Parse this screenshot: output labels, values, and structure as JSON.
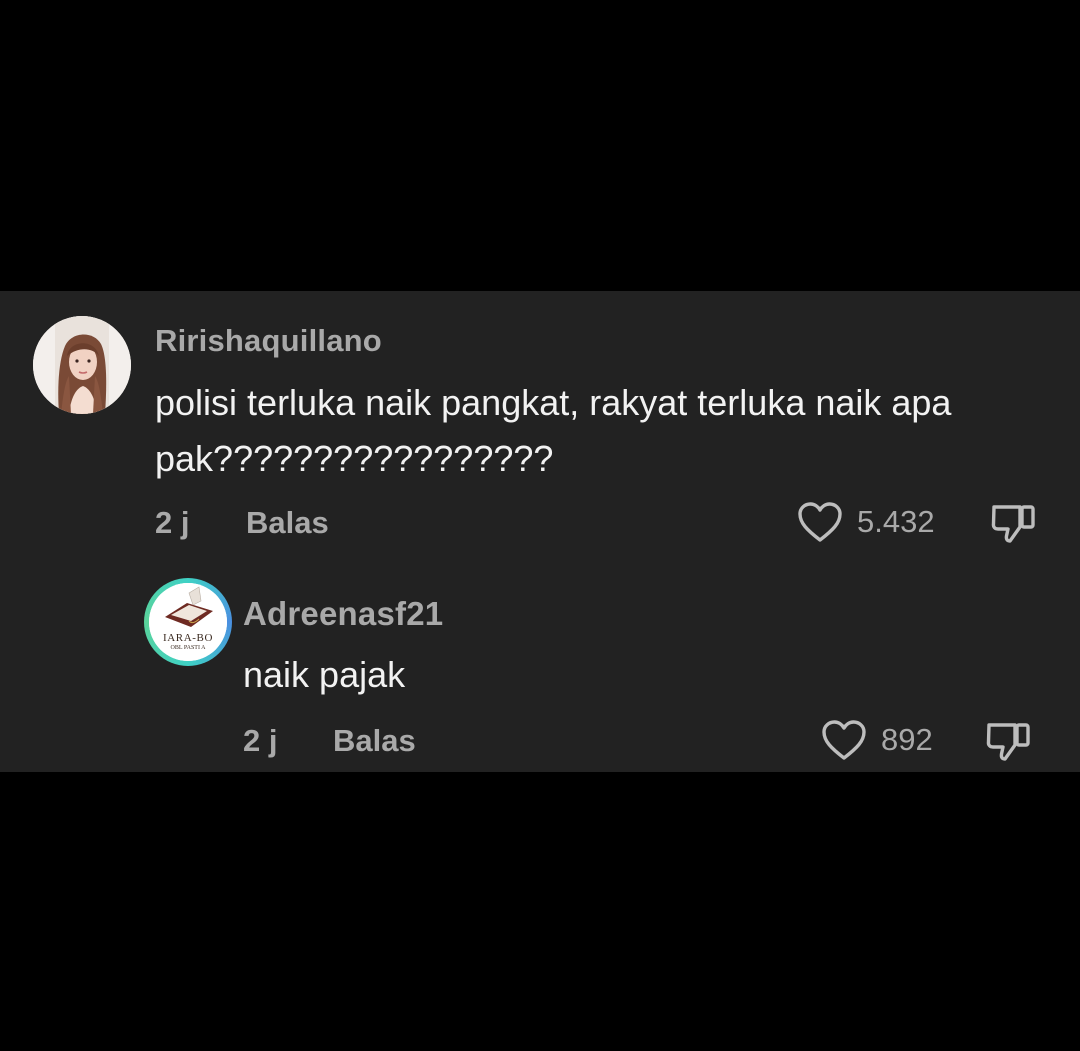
{
  "comments": [
    {
      "username": "Ririshaquillano",
      "text": "polisi terluka naik pangkat, rakyat terluka naik apa pak?????????????????",
      "time": "2 j",
      "reply_label": "Balas",
      "likes": "5.432",
      "avatar_icon": "woman-portrait-avatar"
    },
    {
      "username": "Adreenasf21",
      "text": "naik pajak",
      "time": "2 j",
      "reply_label": "Balas",
      "likes": "892",
      "avatar_icon": "book-logo-avatar",
      "avatar_logo_text_top": "IARA-BO",
      "avatar_logo_text_bottom": "OBL PASTI A"
    }
  ],
  "colors": {
    "page_background": "#000000",
    "panel_background": "#222222",
    "username": "#a9a9a9",
    "comment_text": "#f2f2f2",
    "meta_text": "#a9a9a9",
    "story_ring": "#3fd1c5"
  }
}
